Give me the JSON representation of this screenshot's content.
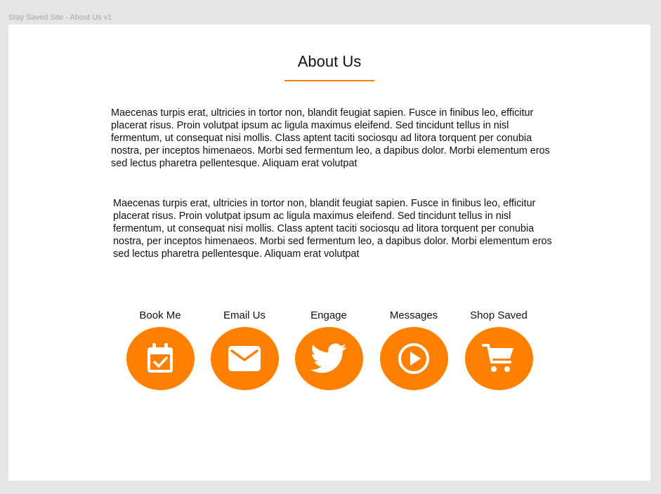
{
  "frame": {
    "label": "Stay Saved Site - About Us v1"
  },
  "page": {
    "title": "About Us"
  },
  "paragraphs": [
    "Maecenas turpis erat, ultricies in tortor non, blandit feugiat sapien. Fusce in finibus leo, efficitur placerat risus. Proin volutpat ipsum ac ligula maximus eleifend. Sed tincidunt tellus in nisl fermentum, ut consequat nisi mollis. Class aptent taciti sociosqu ad litora torquent per conubia nostra, per inceptos himenaeos. Morbi sed fermentum leo, a dapibus dolor. Morbi elementum eros sed lectus pharetra pellentesque. Aliquam erat volutpat",
    "Maecenas turpis erat, ultricies in tortor non, blandit feugiat sapien. Fusce in finibus leo, efficitur placerat risus. Proin volutpat ipsum ac ligula maximus eleifend. Sed tincidunt tellus in nisl fermentum, ut consequat nisi mollis. Class aptent taciti sociosqu ad litora torquent per conubia nostra, per inceptos himenaeos. Morbi sed fermentum leo, a dapibus dolor. Morbi elementum eros sed lectus pharetra pellentesque. Aliquam erat volutpat"
  ],
  "actions": [
    {
      "label": "Book Me",
      "icon": "calendar-check-icon"
    },
    {
      "label": "Email Us",
      "icon": "envelope-icon"
    },
    {
      "label": "Engage",
      "icon": "twitter-bird-icon"
    },
    {
      "label": "Messages",
      "icon": "play-circle-icon"
    },
    {
      "label": "Shop Saved",
      "icon": "shopping-cart-icon"
    }
  ],
  "colors": {
    "accent": "#ff8000",
    "canvas": "#e5e5e5",
    "artboard": "#ffffff",
    "text": "#111111",
    "frame_label": "#a6a6a6"
  }
}
